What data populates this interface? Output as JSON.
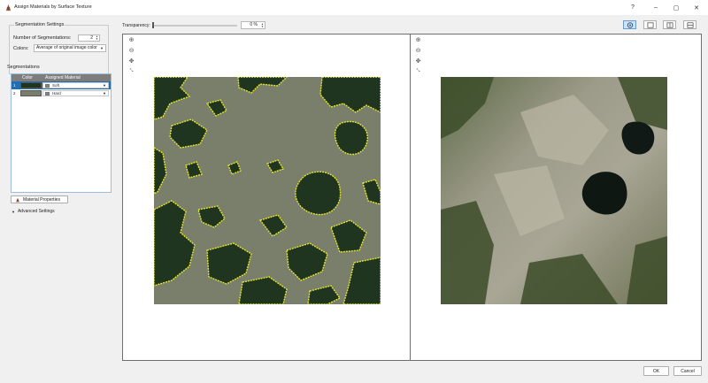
{
  "window": {
    "title": "Assign Materials by Surface Texture",
    "controls": {
      "help": "?",
      "minimize": "–",
      "restore": "▢",
      "close": "✕"
    }
  },
  "settings": {
    "group_title": "Segmentation Settings",
    "num_label": "Number of Segmentations:",
    "num_value": "2",
    "colors_label": "Colors:",
    "colors_value": "Average of original image color"
  },
  "segmentations": {
    "heading": "Segmentations",
    "col_color": "Color",
    "col_material": "Assigned Material",
    "rows": [
      {
        "num": "1",
        "swatch": "#1f3520",
        "material": "Soft",
        "chip": "#7e8c6c"
      },
      {
        "num": "2",
        "swatch": "#7a7f6c",
        "material": "Hard",
        "chip": "#7b8290"
      }
    ]
  },
  "buttons": {
    "material_properties": "Material Properties",
    "advanced_settings": "Advanced Settings",
    "ok": "OK",
    "cancel": "Cancel"
  },
  "toolbar": {
    "transparency_label": "Transparency:",
    "transparency_value": "0 %",
    "transparency_fraction": 0.0
  },
  "view_modes": [
    "pan-view-icon",
    "single-view-icon",
    "side-by-side-icon",
    "stacked-view-icon"
  ],
  "colors": {
    "accent": "#1e6fb8",
    "segment_soft": "#1f3520",
    "segment_hard": "#7a7f6c",
    "outline": "#e5e52a"
  }
}
